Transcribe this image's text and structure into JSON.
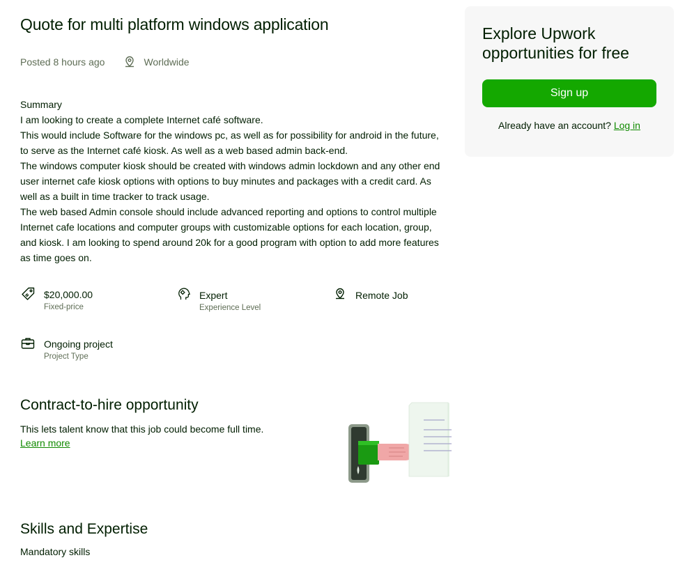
{
  "job": {
    "title": "Quote for multi platform windows application",
    "posted_prefix": "Posted",
    "posted_time": "8 hours ago",
    "location": "Worldwide",
    "summary_label": "Summary",
    "summary_paragraphs": [
      "I am looking to create a complete Internet café software.",
      "This would include Software for the windows pc, as well as for possibility for android in the future, to serve as the Internet café kiosk. As well as a web based admin back-end.",
      "The windows computer kiosk should be created with windows admin lockdown and any other end user internet cafe kiosk options with options to buy minutes and packages with a credit card. As well as a built in time tracker to track usage.",
      "The web based Admin console should include advanced reporting and options to control multiple Internet cafe locations and computer groups with customizable options for each location, group, and kiosk. I am looking to spend around 20k for a good program with option to add more features as time goes on."
    ]
  },
  "features": {
    "price": {
      "value": "$20,000.00",
      "sub": "Fixed-price",
      "icon": "price-tag-icon"
    },
    "level": {
      "value": "Expert",
      "sub": "Experience Level",
      "icon": "expert-head-icon"
    },
    "remote": {
      "value": "Remote Job",
      "icon": "location-pin-icon"
    },
    "project": {
      "value": "Ongoing project",
      "sub": "Project Type",
      "icon": "briefcase-icon"
    }
  },
  "contract": {
    "heading": "Contract-to-hire opportunity",
    "text": "This lets talent know that this job could become full time.",
    "link": "Learn more"
  },
  "skills": {
    "heading": "Skills and Expertise",
    "mandatory_label": "Mandatory skills"
  },
  "sidebar": {
    "title": "Explore Upwork opportunities for free",
    "signup_label": "Sign up",
    "login_prompt": "Already have an account?",
    "login_link": "Log in"
  },
  "colors": {
    "brand_green": "#14a800",
    "link_green": "#108a00",
    "text": "#001e00",
    "muted": "#5e6d55",
    "card_bg": "#f7f7f7"
  }
}
